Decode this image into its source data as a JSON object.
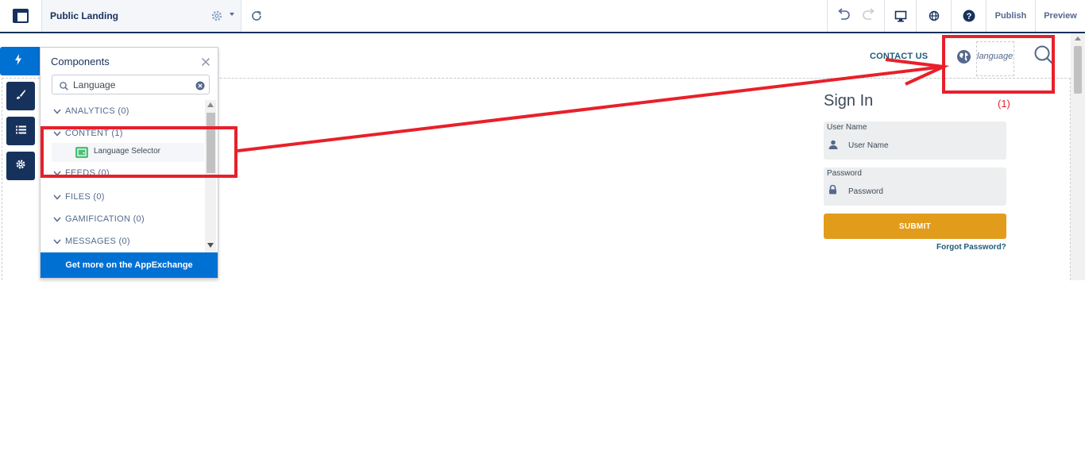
{
  "topbar": {
    "page_name": "Public Landing",
    "publish_label": "Publish",
    "preview_label": "Preview"
  },
  "header": {
    "contact_label": "CONTACT US",
    "language_label": "language"
  },
  "signin": {
    "title": "Sign In",
    "username_label": "User Name",
    "username_placeholder": "User Name",
    "password_label": "Password",
    "password_placeholder": "Password",
    "submit_label": "SUBMIT",
    "forgot_label": "Forgot Password?"
  },
  "panel": {
    "title": "Components",
    "search_value": "Language",
    "categories": [
      {
        "label": "ANALYTICS (0)"
      },
      {
        "label": "CONTENT (1)"
      },
      {
        "label": "FEEDS (0)"
      },
      {
        "label": "FILES (0)"
      },
      {
        "label": "GAMIFICATION (0)"
      },
      {
        "label": "MESSAGES (0)"
      }
    ],
    "item_label": "Language Selector",
    "footer_label": "Get more on the AppExchange"
  },
  "annotation": {
    "label": "(1)",
    "color": "#e8202a"
  },
  "colors": {
    "brand_navy": "#16325c",
    "accent_blue": "#0070d2",
    "submit_orange": "#e29c1c",
    "link_teal": "#1d5b7a"
  }
}
